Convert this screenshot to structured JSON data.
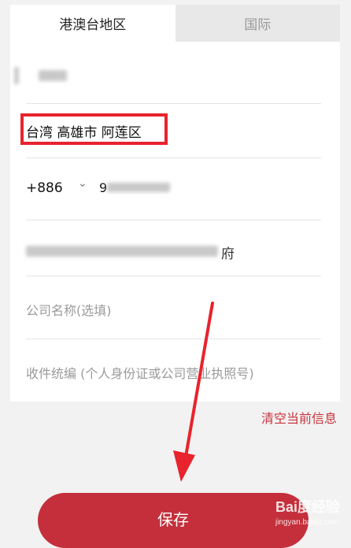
{
  "tabs": [
    {
      "label": "港澳台地区",
      "active": true
    },
    {
      "label": "国际",
      "active": false
    }
  ],
  "form": {
    "region": "台湾 高雄市 阿莲区",
    "phone_code": "+886",
    "phone_prefix": "9",
    "address_suffix": "府",
    "company_placeholder": "公司名称(选填)",
    "id_placeholder": "收件统编 (个人身份证或公司营业执照号)"
  },
  "clear_label": "清空当前信息",
  "save_label": "保存",
  "watermark": {
    "logo": "Bai度经验",
    "url": "jingyan.baidu.com"
  },
  "colors": {
    "accent": "#c42f3b",
    "highlight": "#e8232d",
    "arrow": "#e8232d"
  }
}
